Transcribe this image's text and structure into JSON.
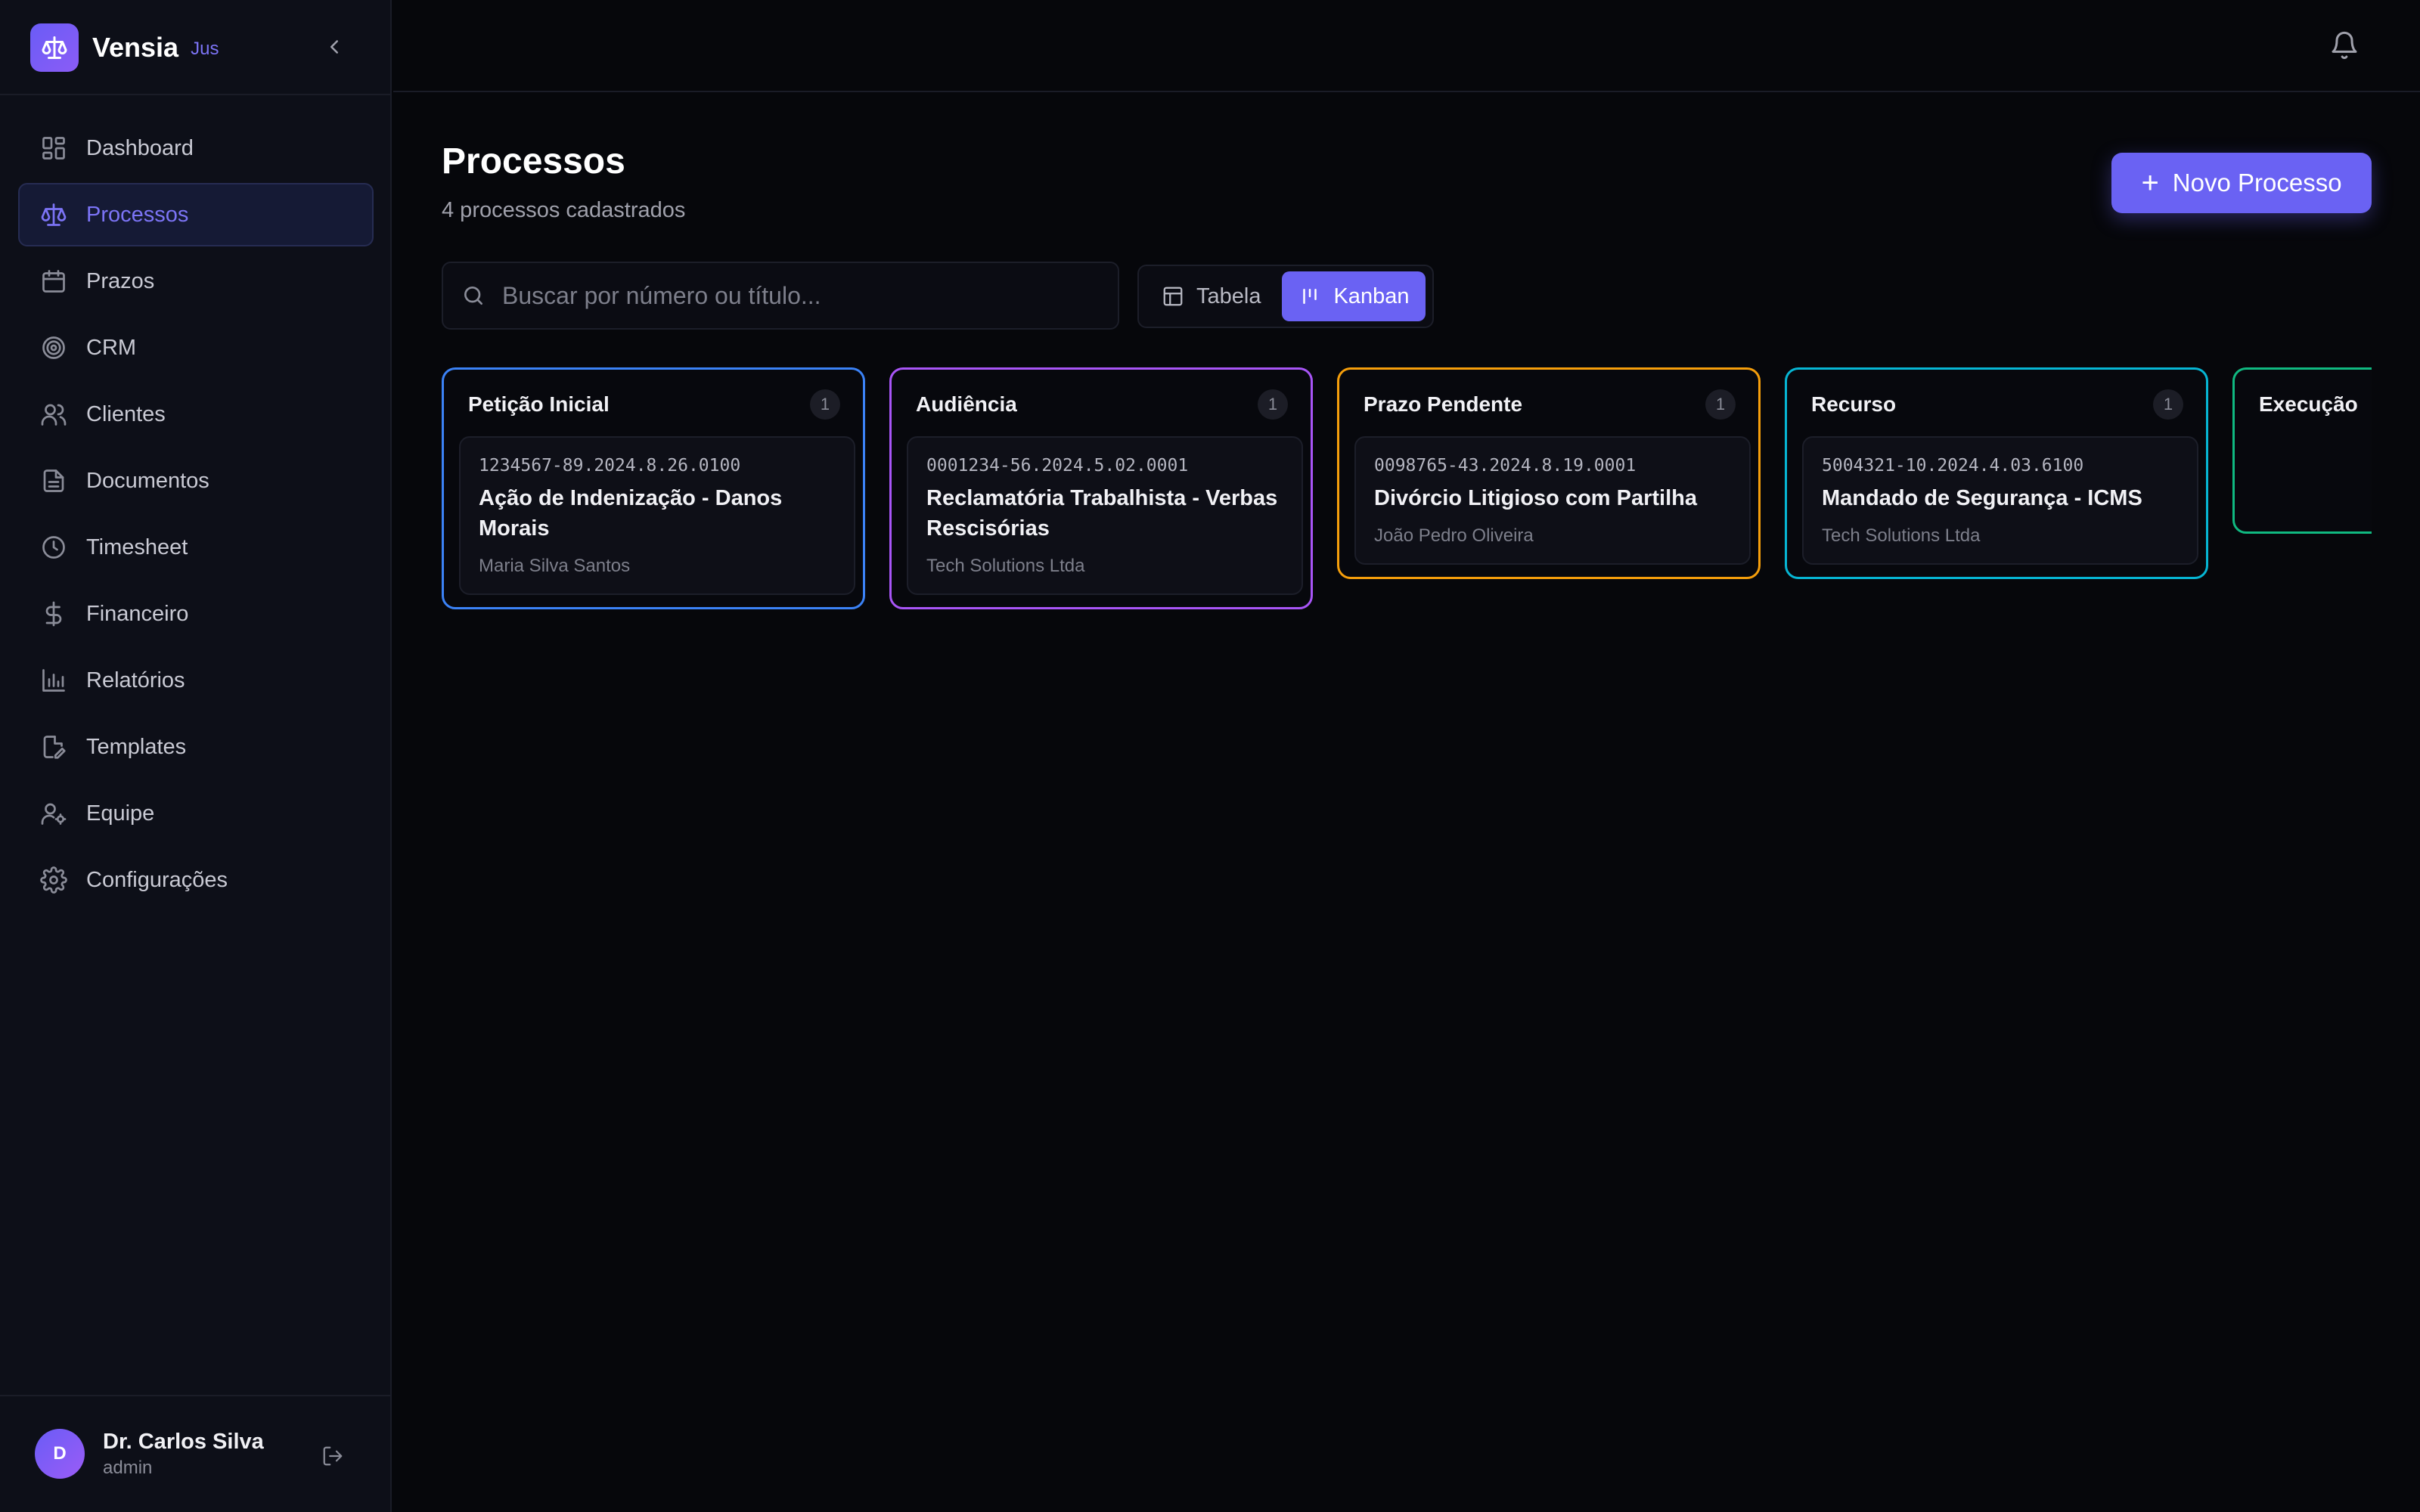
{
  "brand": {
    "name": "Vensia",
    "tag": "Jus"
  },
  "sidebar": {
    "items": [
      {
        "label": "Dashboard",
        "icon": "dashboard-icon",
        "active": false
      },
      {
        "label": "Processos",
        "icon": "scale-icon",
        "active": true
      },
      {
        "label": "Prazos",
        "icon": "calendar-icon",
        "active": false
      },
      {
        "label": "CRM",
        "icon": "target-icon",
        "active": false
      },
      {
        "label": "Clientes",
        "icon": "users-icon",
        "active": false
      },
      {
        "label": "Documentos",
        "icon": "document-icon",
        "active": false
      },
      {
        "label": "Timesheet",
        "icon": "clock-icon",
        "active": false
      },
      {
        "label": "Financeiro",
        "icon": "dollar-icon",
        "active": false
      },
      {
        "label": "Relatórios",
        "icon": "bar-chart-icon",
        "active": false
      },
      {
        "label": "Templates",
        "icon": "edit-document-icon",
        "active": false
      },
      {
        "label": "Equipe",
        "icon": "user-gear-icon",
        "active": false
      },
      {
        "label": "Configurações",
        "icon": "gear-icon",
        "active": false
      }
    ]
  },
  "user": {
    "initial": "D",
    "name": "Dr. Carlos Silva",
    "role": "admin"
  },
  "page": {
    "title": "Processos",
    "subtitle": "4 processos cadastrados",
    "new_button": "Novo Processo"
  },
  "search": {
    "placeholder": "Buscar por número ou título...",
    "value": ""
  },
  "view_toggle": {
    "table": "Tabela",
    "kanban": "Kanban",
    "selected": "Kanban"
  },
  "accent": "#6a62f3",
  "board": {
    "columns": [
      {
        "title": "Petição Inicial",
        "count": "1",
        "color": "#3b82f6",
        "cards": [
          {
            "number": "1234567-89.2024.8.26.0100",
            "title": "Ação de Indenização - Danos Morais",
            "client": "Maria Silva Santos"
          }
        ]
      },
      {
        "title": "Audiência",
        "count": "1",
        "color": "#a855f7",
        "cards": [
          {
            "number": "0001234-56.2024.5.02.0001",
            "title": "Reclamatória Trabalhista - Verbas Rescisórias",
            "client": "Tech Solutions Ltda"
          }
        ]
      },
      {
        "title": "Prazo Pendente",
        "count": "1",
        "color": "#f59e0b",
        "cards": [
          {
            "number": "0098765-43.2024.8.19.0001",
            "title": "Divórcio Litigioso com Partilha",
            "client": "João Pedro Oliveira"
          }
        ]
      },
      {
        "title": "Recurso",
        "count": "1",
        "color": "#06b6d4",
        "cards": [
          {
            "number": "5004321-10.2024.4.03.6100",
            "title": "Mandado de Segurança - ICMS",
            "client": "Tech Solutions Ltda"
          }
        ]
      },
      {
        "title": "Execução",
        "count": "",
        "color": "#10b981",
        "cards": []
      }
    ]
  }
}
